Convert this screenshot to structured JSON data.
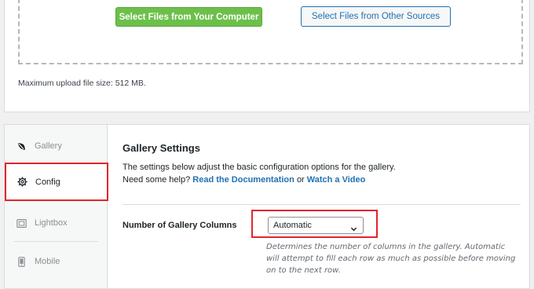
{
  "upload": {
    "select_computer_label": "Select Files from Your Computer",
    "select_other_label": "Select Files from Other Sources",
    "max_upload_text": "Maximum upload file size: 512 MB."
  },
  "sidebar": {
    "items": [
      {
        "label": "Gallery",
        "icon": "leaf-icon"
      },
      {
        "label": "Config",
        "icon": "gear-icon",
        "active": true
      },
      {
        "label": "Lightbox",
        "icon": "lightbox-icon"
      },
      {
        "label": "Mobile",
        "icon": "mobile-icon"
      }
    ]
  },
  "settings": {
    "title": "Gallery Settings",
    "desc_line1": "The settings below adjust the basic configuration options for the gallery.",
    "desc_line2_prefix": "Need some help?",
    "docs_link": "Read the Documentation",
    "or_text": "or",
    "video_link": "Watch a Video",
    "columns_label": "Number of Gallery Columns",
    "columns_value": "Automatic",
    "columns_help": "Determines the number of columns in the gallery. Automatic will attempt to fill each row as much as possible before moving on to the next row."
  },
  "colors": {
    "primary_green": "#6cc04a",
    "link_blue": "#2271b1",
    "highlight_red": "#e0262b"
  }
}
